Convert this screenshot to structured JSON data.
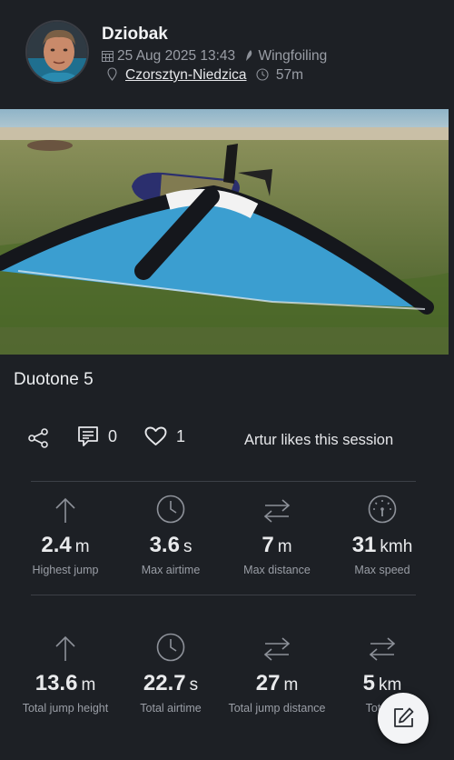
{
  "header": {
    "user_name": "Dziobak",
    "date": "25 Aug 2025 13:43",
    "sport": "Wingfoiling",
    "location": "Czorsztyn-Niedzica",
    "duration": "57m"
  },
  "session": {
    "title": "Duotone 5"
  },
  "actions": {
    "comments_count": "0",
    "likes_count": "1",
    "likes_text": "Artur likes this session"
  },
  "stats_row1": [
    {
      "value": "2.4",
      "unit": "m",
      "label": "Highest jump",
      "icon": "arrow-up-icon"
    },
    {
      "value": "3.6",
      "unit": "s",
      "label": "Max airtime",
      "icon": "clock-icon"
    },
    {
      "value": "7",
      "unit": "m",
      "label": "Max distance",
      "icon": "swap-arrows-icon"
    },
    {
      "value": "31",
      "unit": "kmh",
      "label": "Max speed",
      "icon": "speedometer-icon"
    }
  ],
  "stats_row2": [
    {
      "value": "13.6",
      "unit": "m",
      "label": "Total jump height",
      "icon": "arrow-up-icon"
    },
    {
      "value": "22.7",
      "unit": "s",
      "label": "Total airtime",
      "icon": "clock-icon"
    },
    {
      "value": "27",
      "unit": "m",
      "label": "Total jump distance",
      "icon": "swap-arrows-icon"
    },
    {
      "value": "5",
      "unit": "km",
      "label": "Total d",
      "icon": "swap-arrows-icon"
    }
  ],
  "fab": {
    "icon": "edit-icon"
  }
}
